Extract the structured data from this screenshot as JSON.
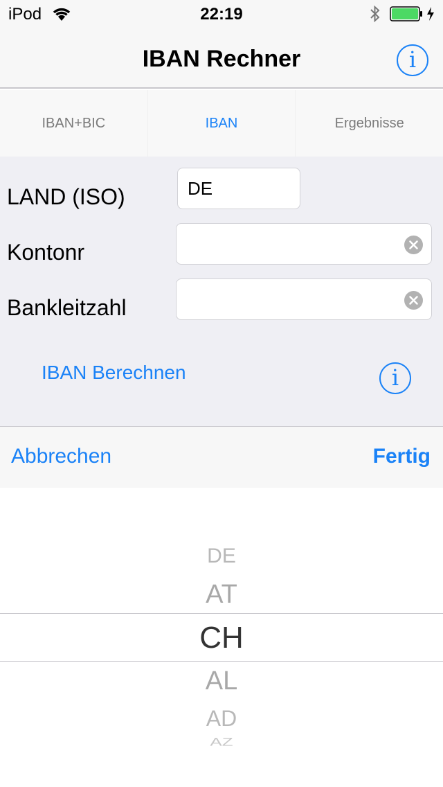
{
  "status_bar": {
    "carrier": "iPod",
    "time": "22:19",
    "battery_level": 1.0
  },
  "nav": {
    "title": "IBAN Rechner",
    "info_icon": "info-icon"
  },
  "tabs": [
    {
      "label": "IBAN+BIC",
      "active": false
    },
    {
      "label": "IBAN",
      "active": true
    },
    {
      "label": "Ergebnisse",
      "active": false
    }
  ],
  "form": {
    "country_label": "LAND (ISO)",
    "country_value": "DE",
    "account_label": "Kontonr",
    "account_value": "",
    "bank_code_label": "Bankleitzahl",
    "bank_code_value": "",
    "calculate_label": "IBAN Berechnen"
  },
  "picker_toolbar": {
    "cancel_label": "Abbrechen",
    "done_label": "Fertig"
  },
  "picker": {
    "items": [
      "DE",
      "AT",
      "CH",
      "AL",
      "AD",
      "AZ"
    ],
    "selected": "CH"
  },
  "colors": {
    "accent": "#1a82f7",
    "form_background": "#efeff4",
    "bar_background": "#f7f7f7"
  }
}
